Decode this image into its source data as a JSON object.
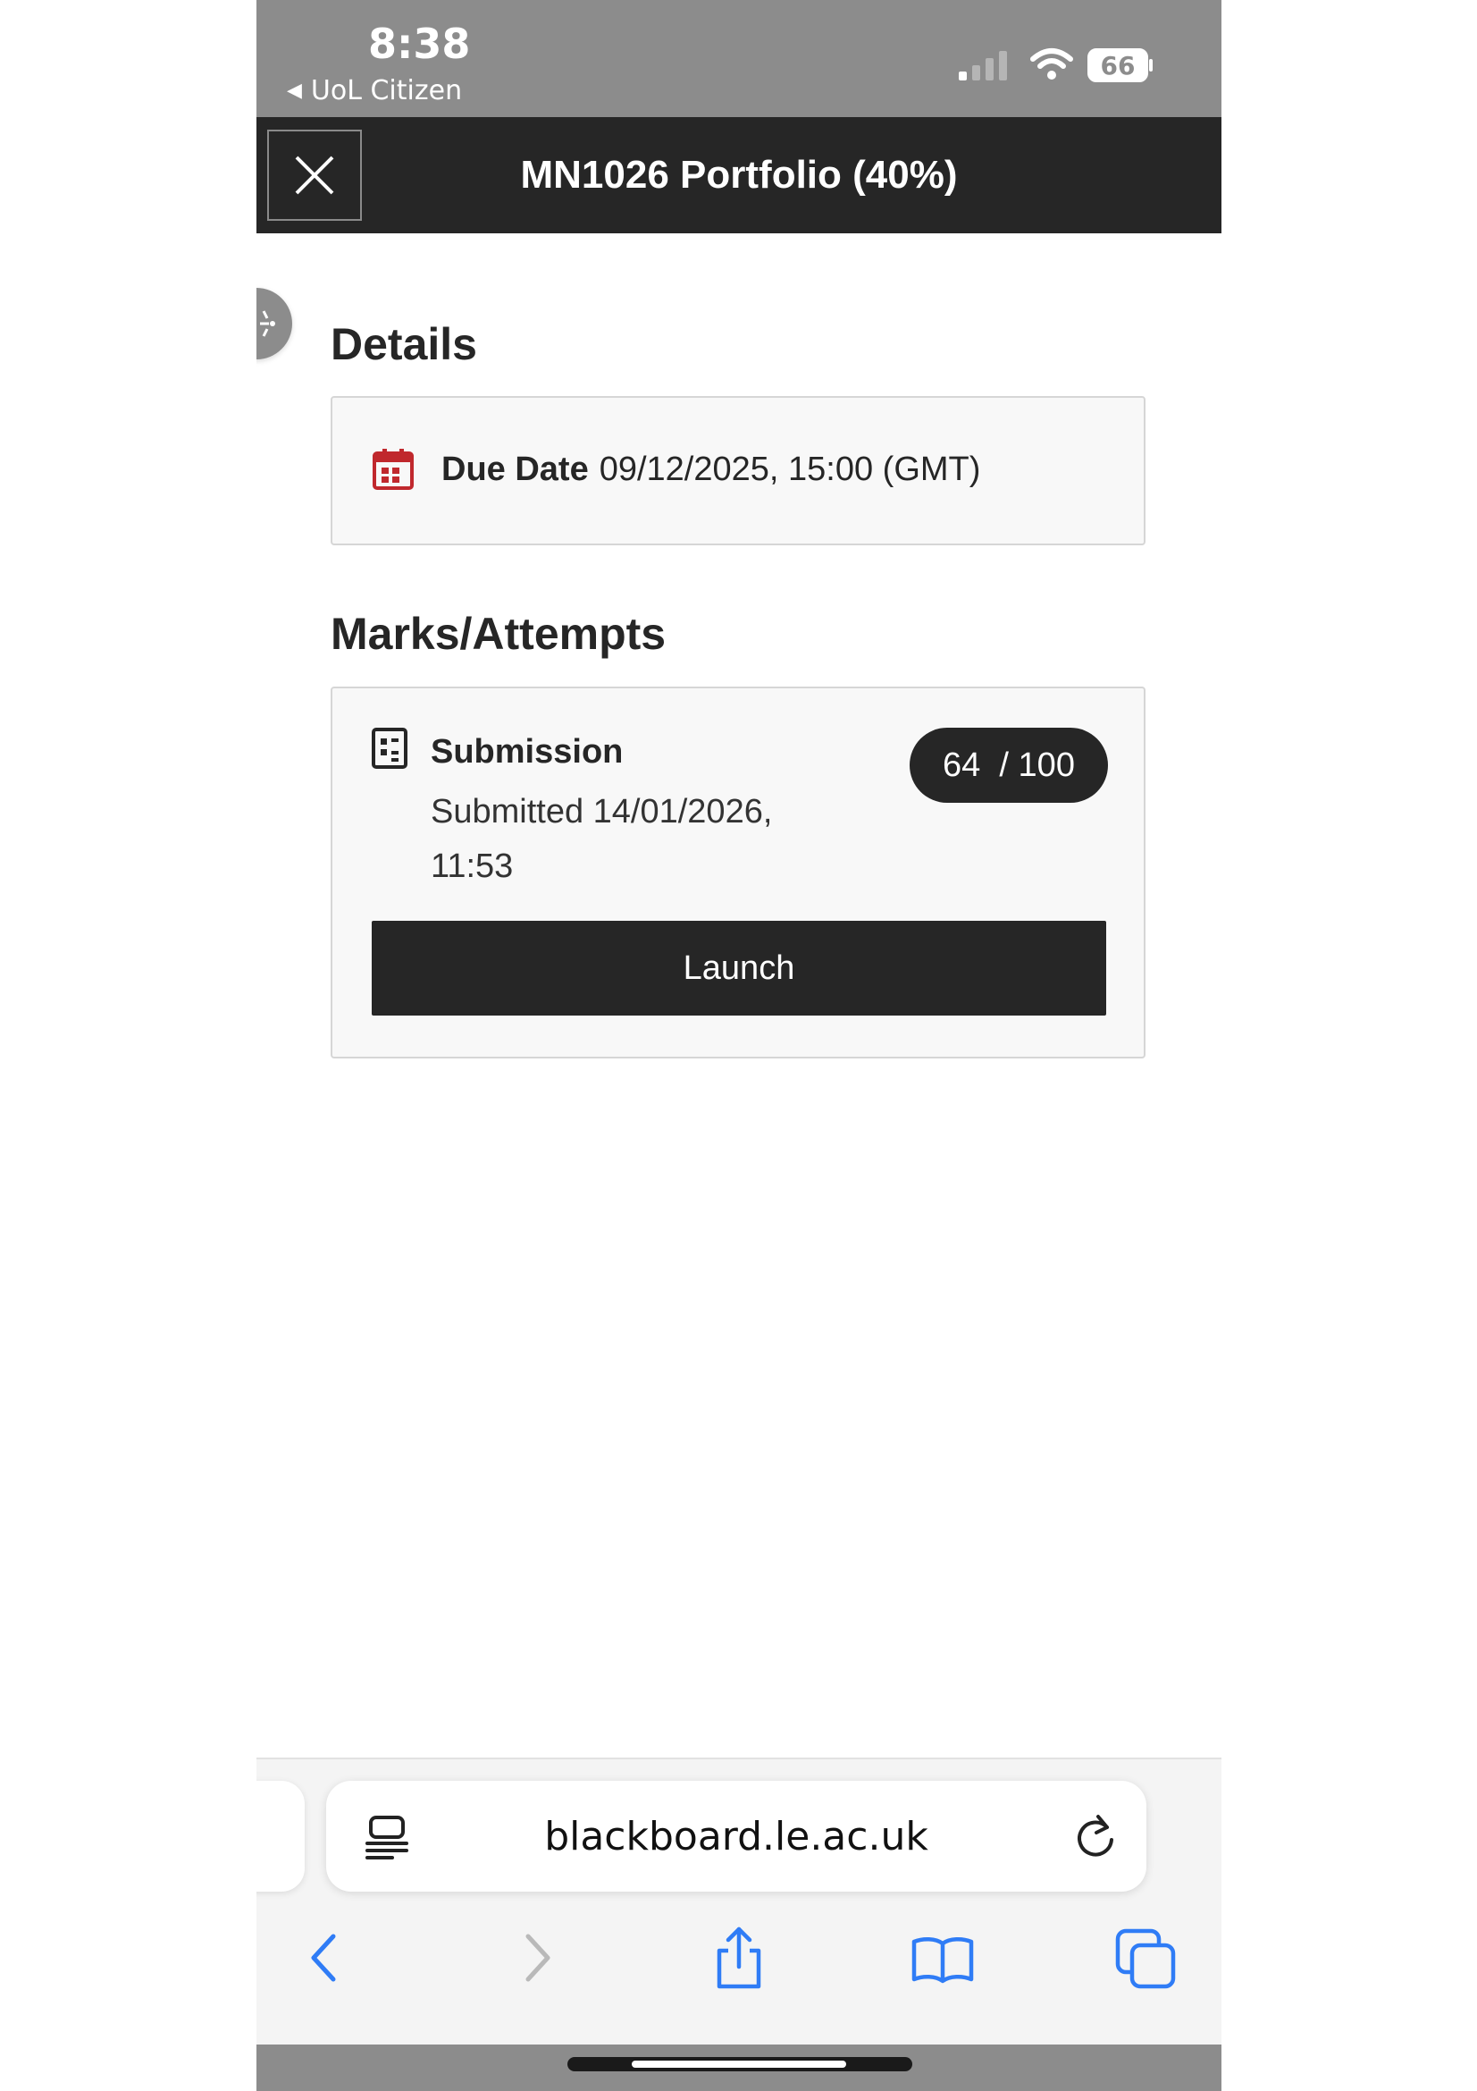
{
  "status_bar": {
    "time": "8:38",
    "back_app": "UoL Citizen",
    "battery": "66"
  },
  "header": {
    "title": "MN1026 Portfolio (40%)"
  },
  "details": {
    "heading": "Details",
    "due_label": "Due Date",
    "due_value": "09/12/2025, 15:00 (GMT)"
  },
  "marks": {
    "heading": "Marks/Attempts",
    "submission_title": "Submission",
    "submitted_text": "Submitted 14/01/2026, 11:53",
    "grade": "64  / 100",
    "launch_label": "Launch"
  },
  "browser": {
    "url": "blackboard.le.ac.uk"
  },
  "colors": {
    "accent_dark": "#262626",
    "calendar_red": "#c0282d",
    "ios_blue": "#2f7cf6"
  }
}
